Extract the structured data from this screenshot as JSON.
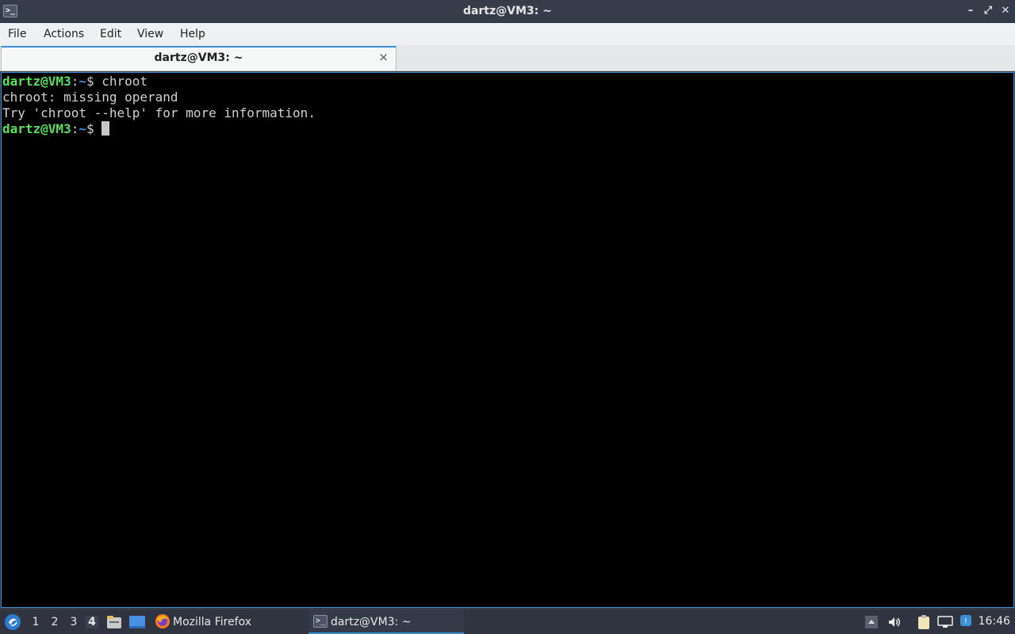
{
  "window": {
    "title": "dartz@VM3: ~",
    "app_icon": ">_",
    "minimize": "–",
    "maximize": "⤢",
    "close": "✕"
  },
  "menu": {
    "file": "File",
    "actions": "Actions",
    "edit": "Edit",
    "view": "View",
    "help": "Help"
  },
  "tab": {
    "label": "dartz@VM3: ~",
    "close": "×"
  },
  "terminal": {
    "line1": {
      "user": "dartz@VM3",
      "sep": ":",
      "path": "~",
      "symbol": "$ ",
      "command": "chroot"
    },
    "line2": "chroot: missing operand",
    "line3": "Try 'chroot --help' for more information.",
    "line4": {
      "user": "dartz@VM3",
      "sep": ":",
      "path": "~",
      "symbol": "$ "
    }
  },
  "taskbar": {
    "workspaces": [
      "1",
      "2",
      "3",
      "4"
    ],
    "active_workspace": "4",
    "firefox_label": "Mozilla Firefox",
    "terminal_label": "dartz@VM3: ~",
    "clock": "16:46"
  },
  "colors": {
    "accent": "#3d8fd6",
    "prompt_user": "#55e155",
    "prompt_path": "#4b8fe0"
  }
}
